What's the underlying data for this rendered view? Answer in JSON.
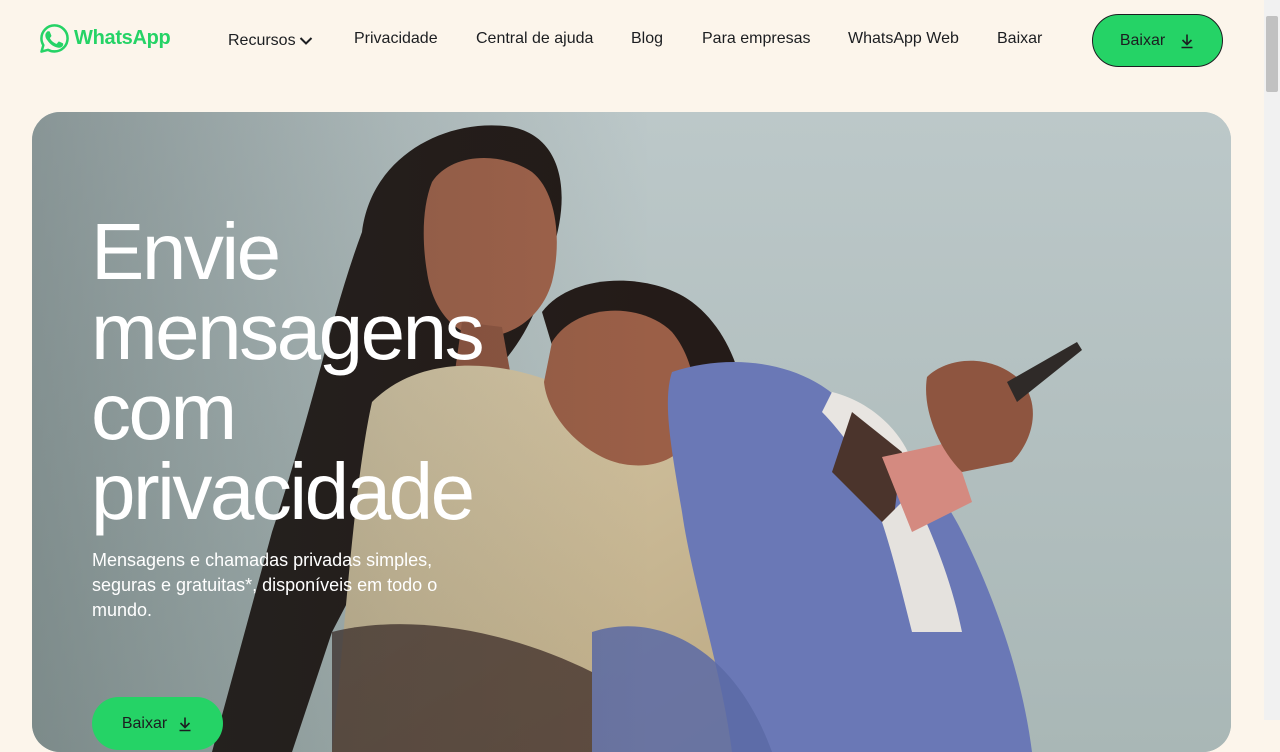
{
  "header": {
    "logo_text": "WhatsApp",
    "nav": [
      {
        "label": "Recursos",
        "has_dropdown": true
      },
      {
        "label": "Privacidade"
      },
      {
        "label": "Central de ajuda"
      },
      {
        "label": "Blog"
      },
      {
        "label": "Para empresas"
      },
      {
        "label": "WhatsApp Web"
      },
      {
        "label": "Baixar"
      }
    ],
    "cta_label": "Baixar",
    "cta_icon": "download-icon"
  },
  "hero": {
    "title_lines": [
      "Envie",
      "mensagens",
      "com",
      "privacidade"
    ],
    "subtitle": "Mensagens e chamadas privadas simples, seguras e gratuitas*, disponíveis em todo o mundo.",
    "button_label": "Baixar",
    "button_icon": "download-icon"
  },
  "colors": {
    "brand": "#25d366",
    "background": "#fcf5eb",
    "text": "#1c1e21"
  }
}
